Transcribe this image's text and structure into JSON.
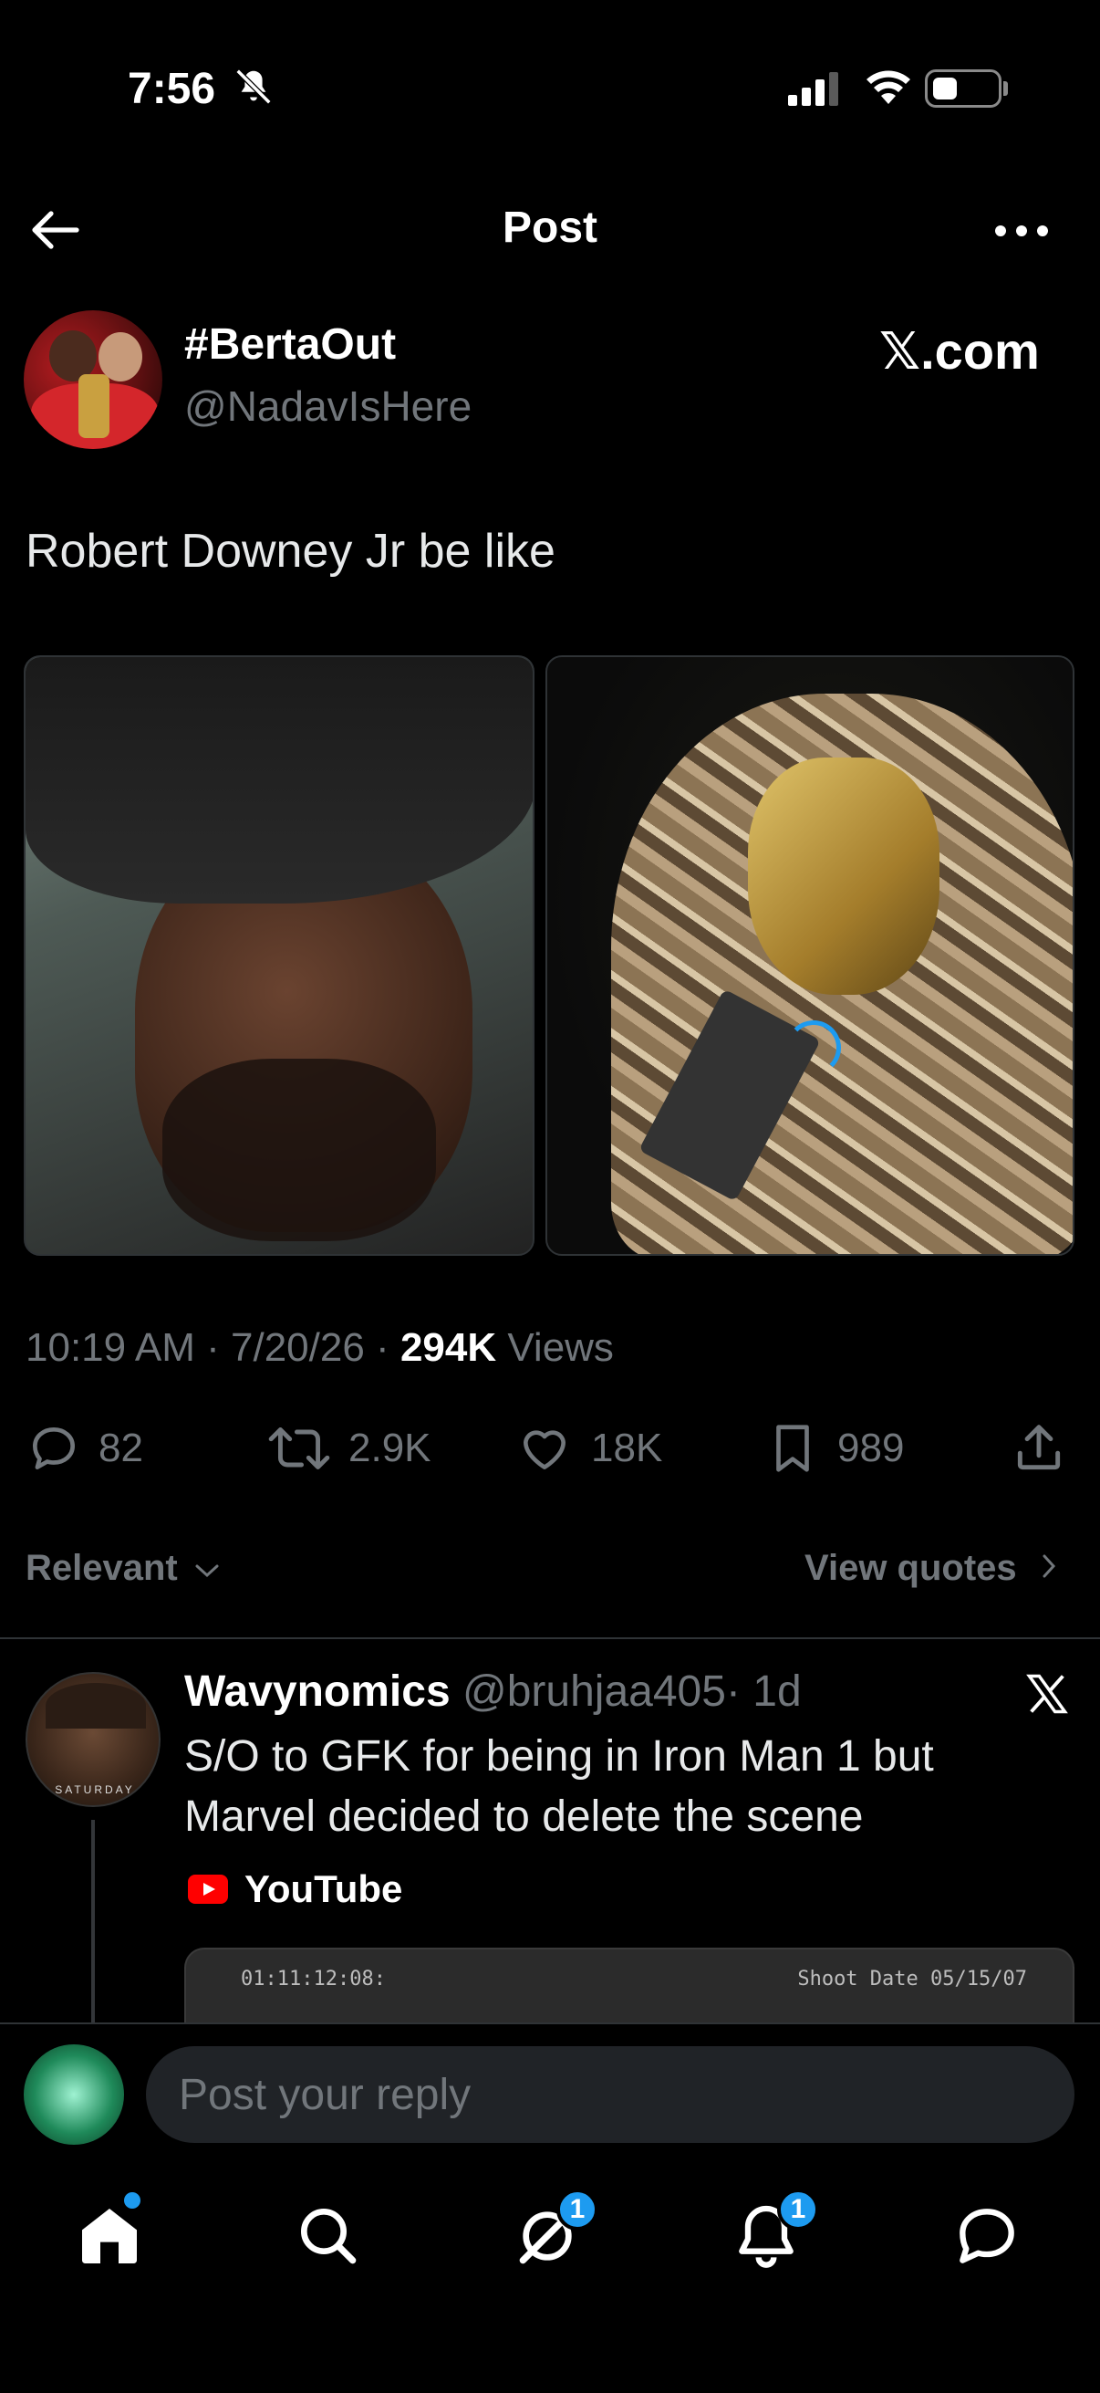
{
  "status_bar": {
    "time": "7:56"
  },
  "header": {
    "title": "Post"
  },
  "post": {
    "display_name": "#BertaOut",
    "handle": "@NadavIsHere",
    "source_label": "𝕏.com",
    "text": "Robert Downey Jr be like",
    "time": "10:19 AM",
    "date": "7/20/26",
    "views_count": "294K",
    "views_label": "Views",
    "actions": {
      "replies": "82",
      "reposts": "2.9K",
      "likes": "18K",
      "bookmarks": "989"
    }
  },
  "filters": {
    "sort_label": "Relevant",
    "view_quotes_label": "View quotes"
  },
  "reply": {
    "avatar_caption": "SATURDAY",
    "name": "Wavynomics",
    "handle": "@bruhjaa405",
    "time": "· 1d",
    "text": "S/O to GFK for being in Iron Man 1 but Marvel decided to delete the scene",
    "link_source": "YouTube",
    "video_timecode": "01:11:12:08:",
    "video_date": "Shoot Date 05/15/07"
  },
  "composer": {
    "placeholder": "Post your reply"
  },
  "tabbar": {
    "messages_badge": "1",
    "notifications_badge": "1"
  },
  "colors": {
    "accent": "#1d9bf0",
    "muted": "#71767b",
    "background": "#000000"
  }
}
